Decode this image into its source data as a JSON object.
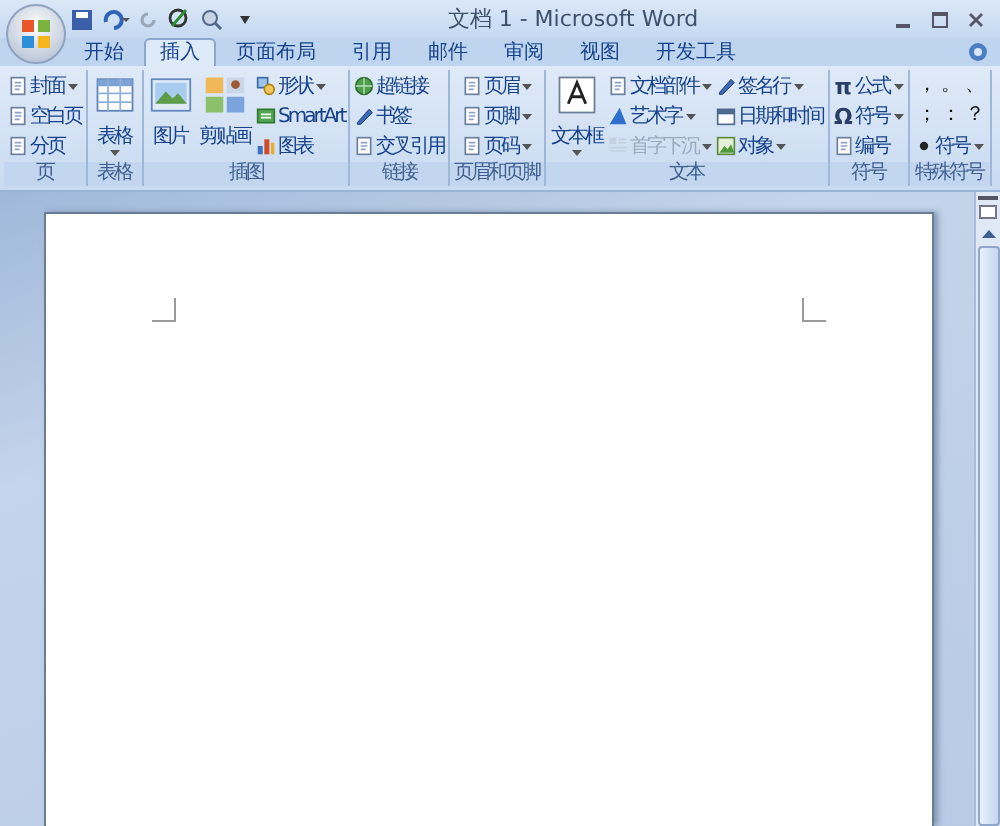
{
  "window": {
    "title": "文档 1 - Microsoft Word"
  },
  "tabs": [
    {
      "label": "开始",
      "selected": false
    },
    {
      "label": "插入",
      "selected": true
    },
    {
      "label": "页面布局",
      "selected": false
    },
    {
      "label": "引用",
      "selected": false
    },
    {
      "label": "邮件",
      "selected": false
    },
    {
      "label": "审阅",
      "selected": false
    },
    {
      "label": "视图",
      "selected": false
    },
    {
      "label": "开发工具",
      "selected": false
    }
  ],
  "ribbon": {
    "groups": [
      {
        "label": "页",
        "columns": [
          {
            "kind": "stack",
            "items": [
              {
                "label": "封面",
                "dropdown": true,
                "disabled": false
              },
              {
                "label": "空白页",
                "dropdown": false,
                "disabled": false
              },
              {
                "label": "分页",
                "dropdown": false,
                "disabled": false
              }
            ]
          }
        ]
      },
      {
        "label": "表格",
        "columns": [
          {
            "kind": "large",
            "label": "表格",
            "dropdown": true
          }
        ]
      },
      {
        "label": "插图",
        "columns": [
          {
            "kind": "large",
            "label": "图片",
            "dropdown": false
          },
          {
            "kind": "large",
            "label": "剪贴画",
            "dropdown": false
          },
          {
            "kind": "stack",
            "items": [
              {
                "label": "形状",
                "dropdown": true,
                "disabled": false
              },
              {
                "label": "SmartArt",
                "dropdown": false,
                "disabled": false
              },
              {
                "label": "图表",
                "dropdown": false,
                "disabled": false
              }
            ]
          }
        ]
      },
      {
        "label": "链接",
        "columns": [
          {
            "kind": "stack",
            "items": [
              {
                "label": "超链接",
                "dropdown": false,
                "disabled": false
              },
              {
                "label": "书签",
                "dropdown": false,
                "disabled": false
              },
              {
                "label": "交叉引用",
                "dropdown": false,
                "disabled": false
              }
            ]
          }
        ]
      },
      {
        "label": "页眉和页脚",
        "columns": [
          {
            "kind": "stack",
            "items": [
              {
                "label": "页眉",
                "dropdown": true,
                "disabled": false
              },
              {
                "label": "页脚",
                "dropdown": true,
                "disabled": false
              },
              {
                "label": "页码",
                "dropdown": true,
                "disabled": false
              }
            ]
          }
        ]
      },
      {
        "label": "文本",
        "columns": [
          {
            "kind": "large",
            "label": "文本框",
            "dropdown": true
          },
          {
            "kind": "stack",
            "items": [
              {
                "label": "文档部件",
                "dropdown": true,
                "disabled": false
              },
              {
                "label": "艺术字",
                "dropdown": true,
                "disabled": false
              },
              {
                "label": "首字下沉",
                "dropdown": true,
                "disabled": true
              }
            ]
          },
          {
            "kind": "stack",
            "items": [
              {
                "label": "签名行",
                "dropdown": true,
                "disabled": false
              },
              {
                "label": "日期和时间",
                "dropdown": false,
                "disabled": false
              },
              {
                "label": "对象",
                "dropdown": true,
                "disabled": false
              }
            ]
          }
        ]
      },
      {
        "label": "符号",
        "columns": [
          {
            "kind": "stack",
            "items": [
              {
                "label": "公式",
                "glyph": "π",
                "dropdown": true,
                "disabled": false
              },
              {
                "label": "符号",
                "glyph": "Ω",
                "dropdown": true,
                "disabled": false
              },
              {
                "label": "编号",
                "dropdown": false,
                "disabled": false
              }
            ]
          }
        ]
      },
      {
        "label": "特殊符号",
        "columns": [
          {
            "kind": "symbols",
            "rows": [
              [
                "，",
                "。",
                "、"
              ],
              [
                "；",
                "：",
                "？"
              ]
            ],
            "items": [
              {
                "label": "符号",
                "dropdown": true,
                "disabled": false
              }
            ]
          }
        ]
      }
    ]
  }
}
